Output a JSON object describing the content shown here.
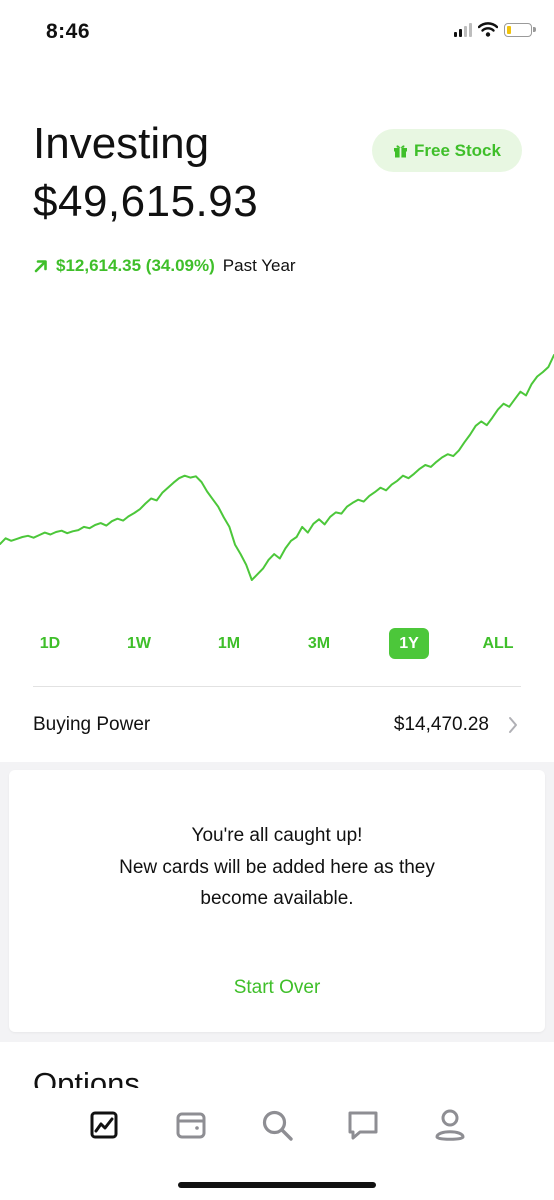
{
  "status_bar": {
    "time": "8:46",
    "icons": [
      "cellular-signal-icon",
      "wifi-icon",
      "battery-low-icon"
    ]
  },
  "header": {
    "title": "Investing",
    "balance": "$49,615.93",
    "free_stock_label": "Free Stock",
    "free_stock_icon": "gift-icon"
  },
  "change": {
    "icon": "arrow-up-right-icon",
    "amount": "$12,614.35 (34.09%)",
    "period": "Past Year"
  },
  "chart_data": {
    "type": "line",
    "series": [
      {
        "values": [
          33.1,
          34.0,
          33.6,
          33.9,
          34.2,
          34.4,
          34.1,
          34.5,
          34.9,
          34.6,
          35.0,
          35.2,
          34.8,
          35.1,
          35.3,
          35.8,
          35.6,
          36.1,
          36.4,
          36.0,
          36.7,
          37.1,
          36.8,
          37.5,
          38.0,
          38.6,
          39.5,
          40.3,
          40.0,
          41.2,
          42.0,
          42.8,
          43.5,
          43.9,
          43.6,
          43.8,
          42.9,
          41.4,
          40.2,
          39.0,
          37.3,
          35.8,
          33.0,
          31.5,
          29.8,
          27.4,
          28.3,
          29.2,
          30.6,
          31.5,
          30.8,
          32.4,
          33.6,
          34.2,
          35.8,
          34.9,
          36.3,
          37.0,
          36.2,
          37.4,
          38.1,
          37.9,
          39.0,
          39.6,
          40.1,
          39.8,
          40.7,
          41.3,
          42.0,
          41.6,
          42.5,
          43.1,
          43.9,
          43.5,
          44.2,
          45.0,
          45.6,
          45.3,
          46.1,
          46.8,
          47.3,
          47.0,
          47.9,
          49.2,
          50.4,
          51.8,
          52.5,
          51.9,
          53.1,
          54.4,
          55.3,
          54.8,
          56.0,
          57.2,
          56.6,
          58.4,
          59.6,
          60.3,
          61.1,
          63.0
        ]
      }
    ],
    "color": "#4cc73a",
    "grid": false,
    "axes": false
  },
  "ranges": {
    "items": [
      "1D",
      "1W",
      "1M",
      "3M",
      "1Y",
      "ALL"
    ],
    "selected": "1Y"
  },
  "buying_power": {
    "label": "Buying Power",
    "value": "$14,470.28",
    "icon": "chevron-right-icon"
  },
  "card": {
    "line1": "You're all caught up!",
    "line2": "New cards will be added here as they",
    "line3": "become available.",
    "action": "Start Over"
  },
  "options": {
    "heading": "Options"
  },
  "tabbar": {
    "items": [
      {
        "icon": "portfolio-chart-icon",
        "active": true
      },
      {
        "icon": "wallet-icon",
        "active": false
      },
      {
        "icon": "search-icon",
        "active": false
      },
      {
        "icon": "messages-icon",
        "active": false
      },
      {
        "icon": "account-icon",
        "active": false
      }
    ]
  },
  "colors": {
    "accent": "#4cc73a",
    "accent_text": "#3fbf2a",
    "accent_bg": "#e8f7e2",
    "text": "#111111",
    "muted": "#8e8e93"
  }
}
